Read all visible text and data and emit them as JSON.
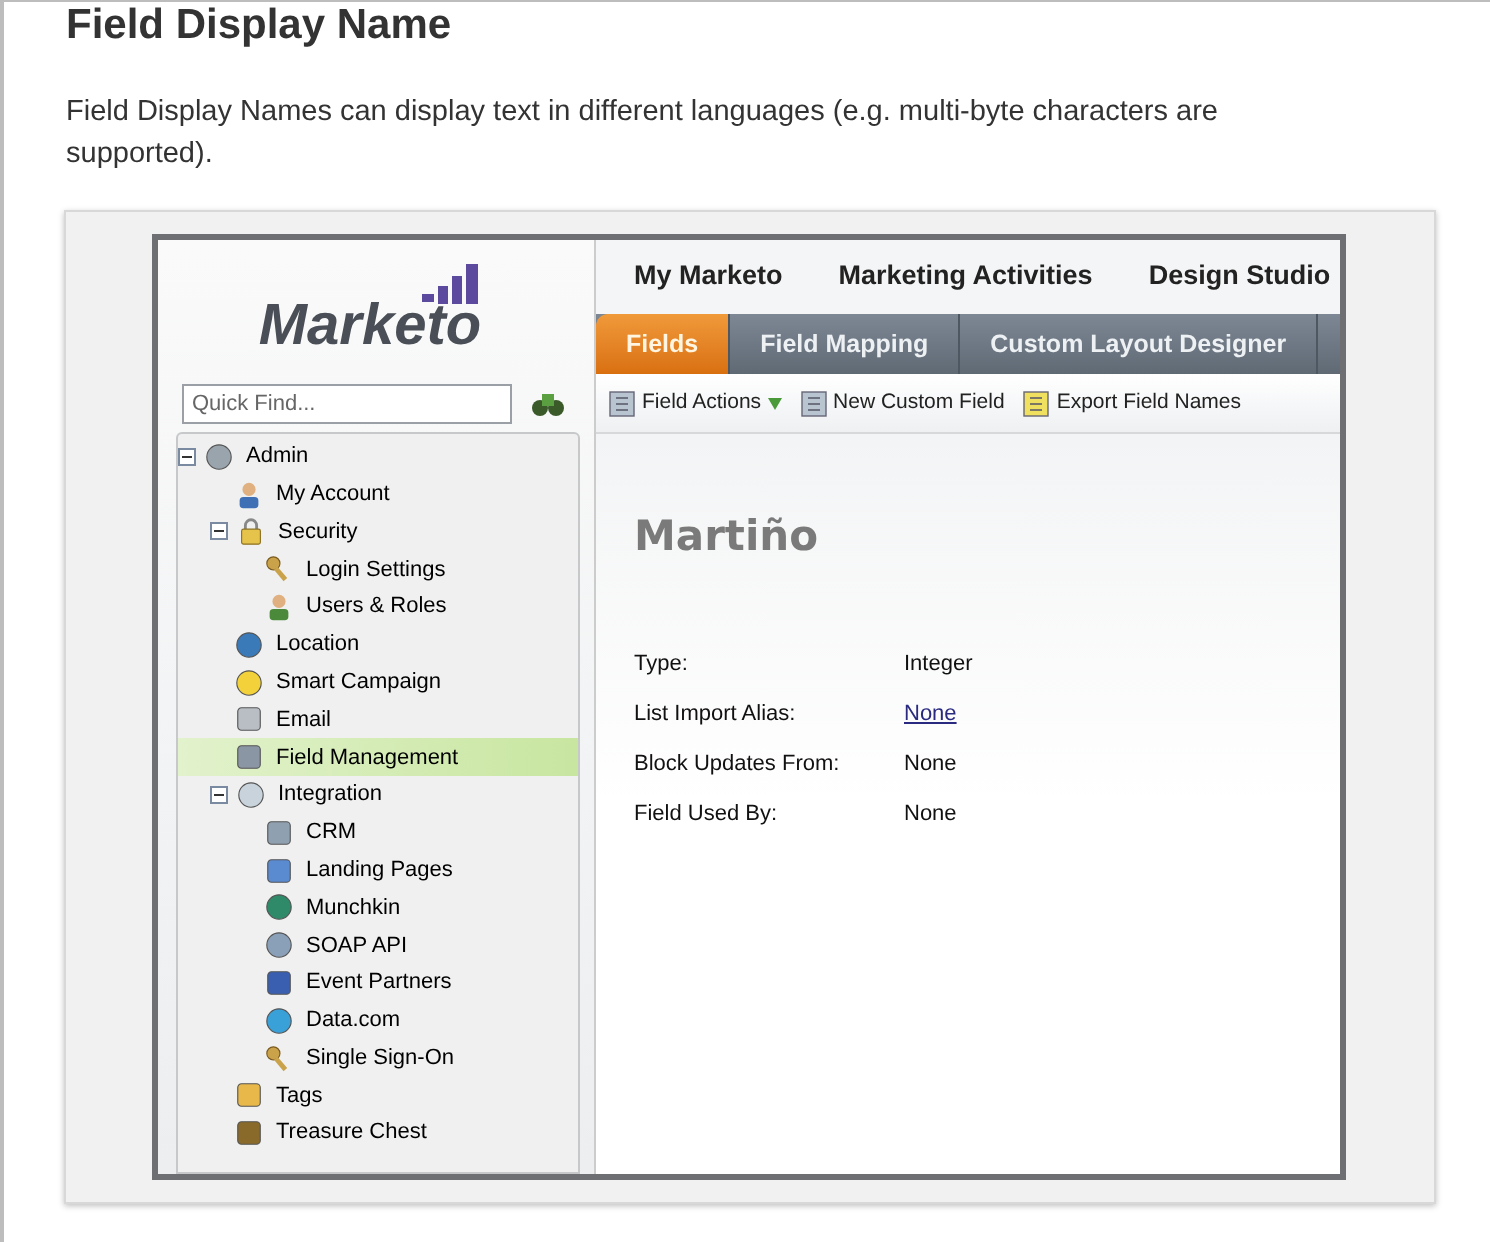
{
  "heading": "Field Display Name",
  "description": "Field Display Names can display text in different languages (e.g. multi-byte characters are supported).",
  "app": {
    "logo": "Marketo",
    "quick_find": {
      "placeholder": "Quick Find..."
    },
    "nav": [
      "My Marketo",
      "Marketing Activities",
      "Design Studio"
    ],
    "tabs": [
      {
        "label": "Fields",
        "selected": true
      },
      {
        "label": "Field Mapping",
        "selected": false
      },
      {
        "label": "Custom Layout Designer",
        "selected": false
      }
    ],
    "toolbar": [
      {
        "label": "Field Actions",
        "dropdown": true
      },
      {
        "label": "New Custom Field",
        "dropdown": false
      },
      {
        "label": "Export Field Names",
        "dropdown": false
      }
    ],
    "tree": [
      {
        "label": "Admin",
        "expanded": true,
        "selected": false,
        "children": [
          {
            "label": "My Account",
            "selected": false
          },
          {
            "label": "Security",
            "expanded": true,
            "selected": false,
            "children": [
              {
                "label": "Login Settings",
                "selected": false
              },
              {
                "label": "Users & Roles",
                "selected": false
              }
            ]
          },
          {
            "label": "Location",
            "selected": false
          },
          {
            "label": "Smart Campaign",
            "selected": false
          },
          {
            "label": "Email",
            "selected": false
          },
          {
            "label": "Field Management",
            "selected": true
          },
          {
            "label": "Integration",
            "expanded": true,
            "selected": false,
            "children": [
              {
                "label": "CRM",
                "selected": false
              },
              {
                "label": "Landing Pages",
                "selected": false
              },
              {
                "label": "Munchkin",
                "selected": false
              },
              {
                "label": "SOAP API",
                "selected": false
              },
              {
                "label": "Event Partners",
                "selected": false
              },
              {
                "label": "Data.com",
                "selected": false
              },
              {
                "label": "Single Sign-On",
                "selected": false
              }
            ]
          },
          {
            "label": "Tags",
            "selected": false
          },
          {
            "label": "Treasure Chest",
            "selected": false
          }
        ]
      }
    ],
    "detail": {
      "title": "Martiño",
      "properties": [
        {
          "label": "Type:",
          "value": "Integer",
          "link": false
        },
        {
          "label": "List Import Alias:",
          "value": "None",
          "link": true
        },
        {
          "label": "Block Updates From:",
          "value": "None",
          "link": false
        },
        {
          "label": "Field Used By:",
          "value": "None",
          "link": false
        }
      ]
    }
  }
}
